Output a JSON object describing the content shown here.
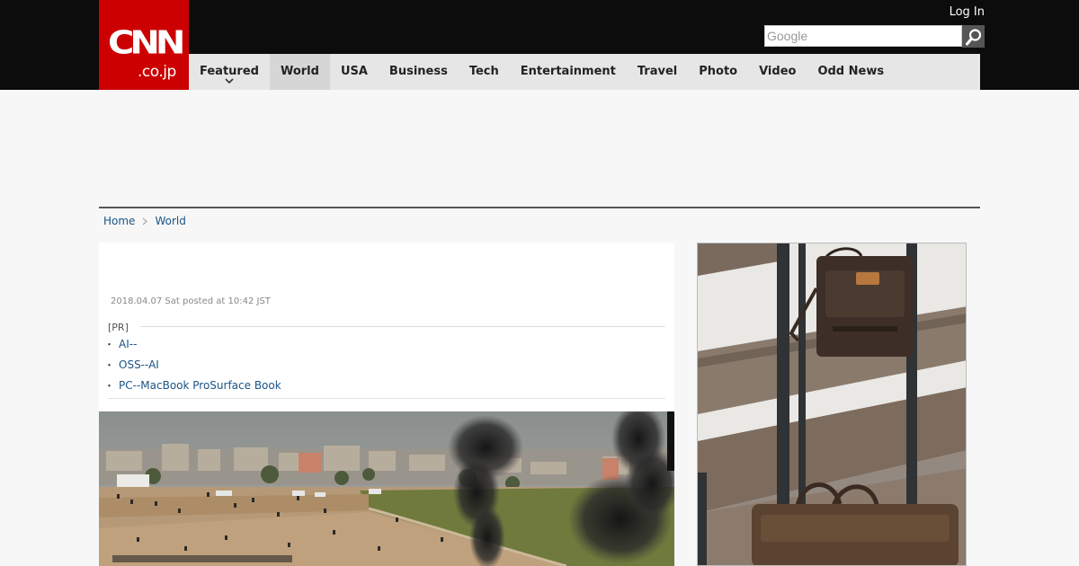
{
  "header": {
    "logo_text": "CNN",
    "logo_sub": ".co.jp",
    "login_label": "Log In",
    "search": {
      "placeholder": "Google",
      "button_icon": "search-icon"
    },
    "nav": [
      {
        "label": "Featured",
        "dropdown": true
      },
      {
        "label": "World",
        "active": true
      },
      {
        "label": "USA"
      },
      {
        "label": "Business"
      },
      {
        "label": "Tech"
      },
      {
        "label": "Entertainment"
      },
      {
        "label": "Travel"
      },
      {
        "label": "Photo"
      },
      {
        "label": "Video"
      },
      {
        "label": "Odd News"
      }
    ]
  },
  "breadcrumb": {
    "home": "Home",
    "current": "World"
  },
  "article": {
    "timestamp": "2018.04.07 Sat posted at 10:42 JST",
    "pr_label": "[PR]",
    "pr_links": [
      "AI--",
      "OSS--AI",
      "PC--MacBook ProSurface Book"
    ],
    "photo_credit_icon": "getty-credit-strip"
  },
  "colors": {
    "brand_red": "#cc0000",
    "header_bg": "#0c0c0c",
    "nav_bg": "#e6e6e6",
    "link": "#1a5487"
  }
}
